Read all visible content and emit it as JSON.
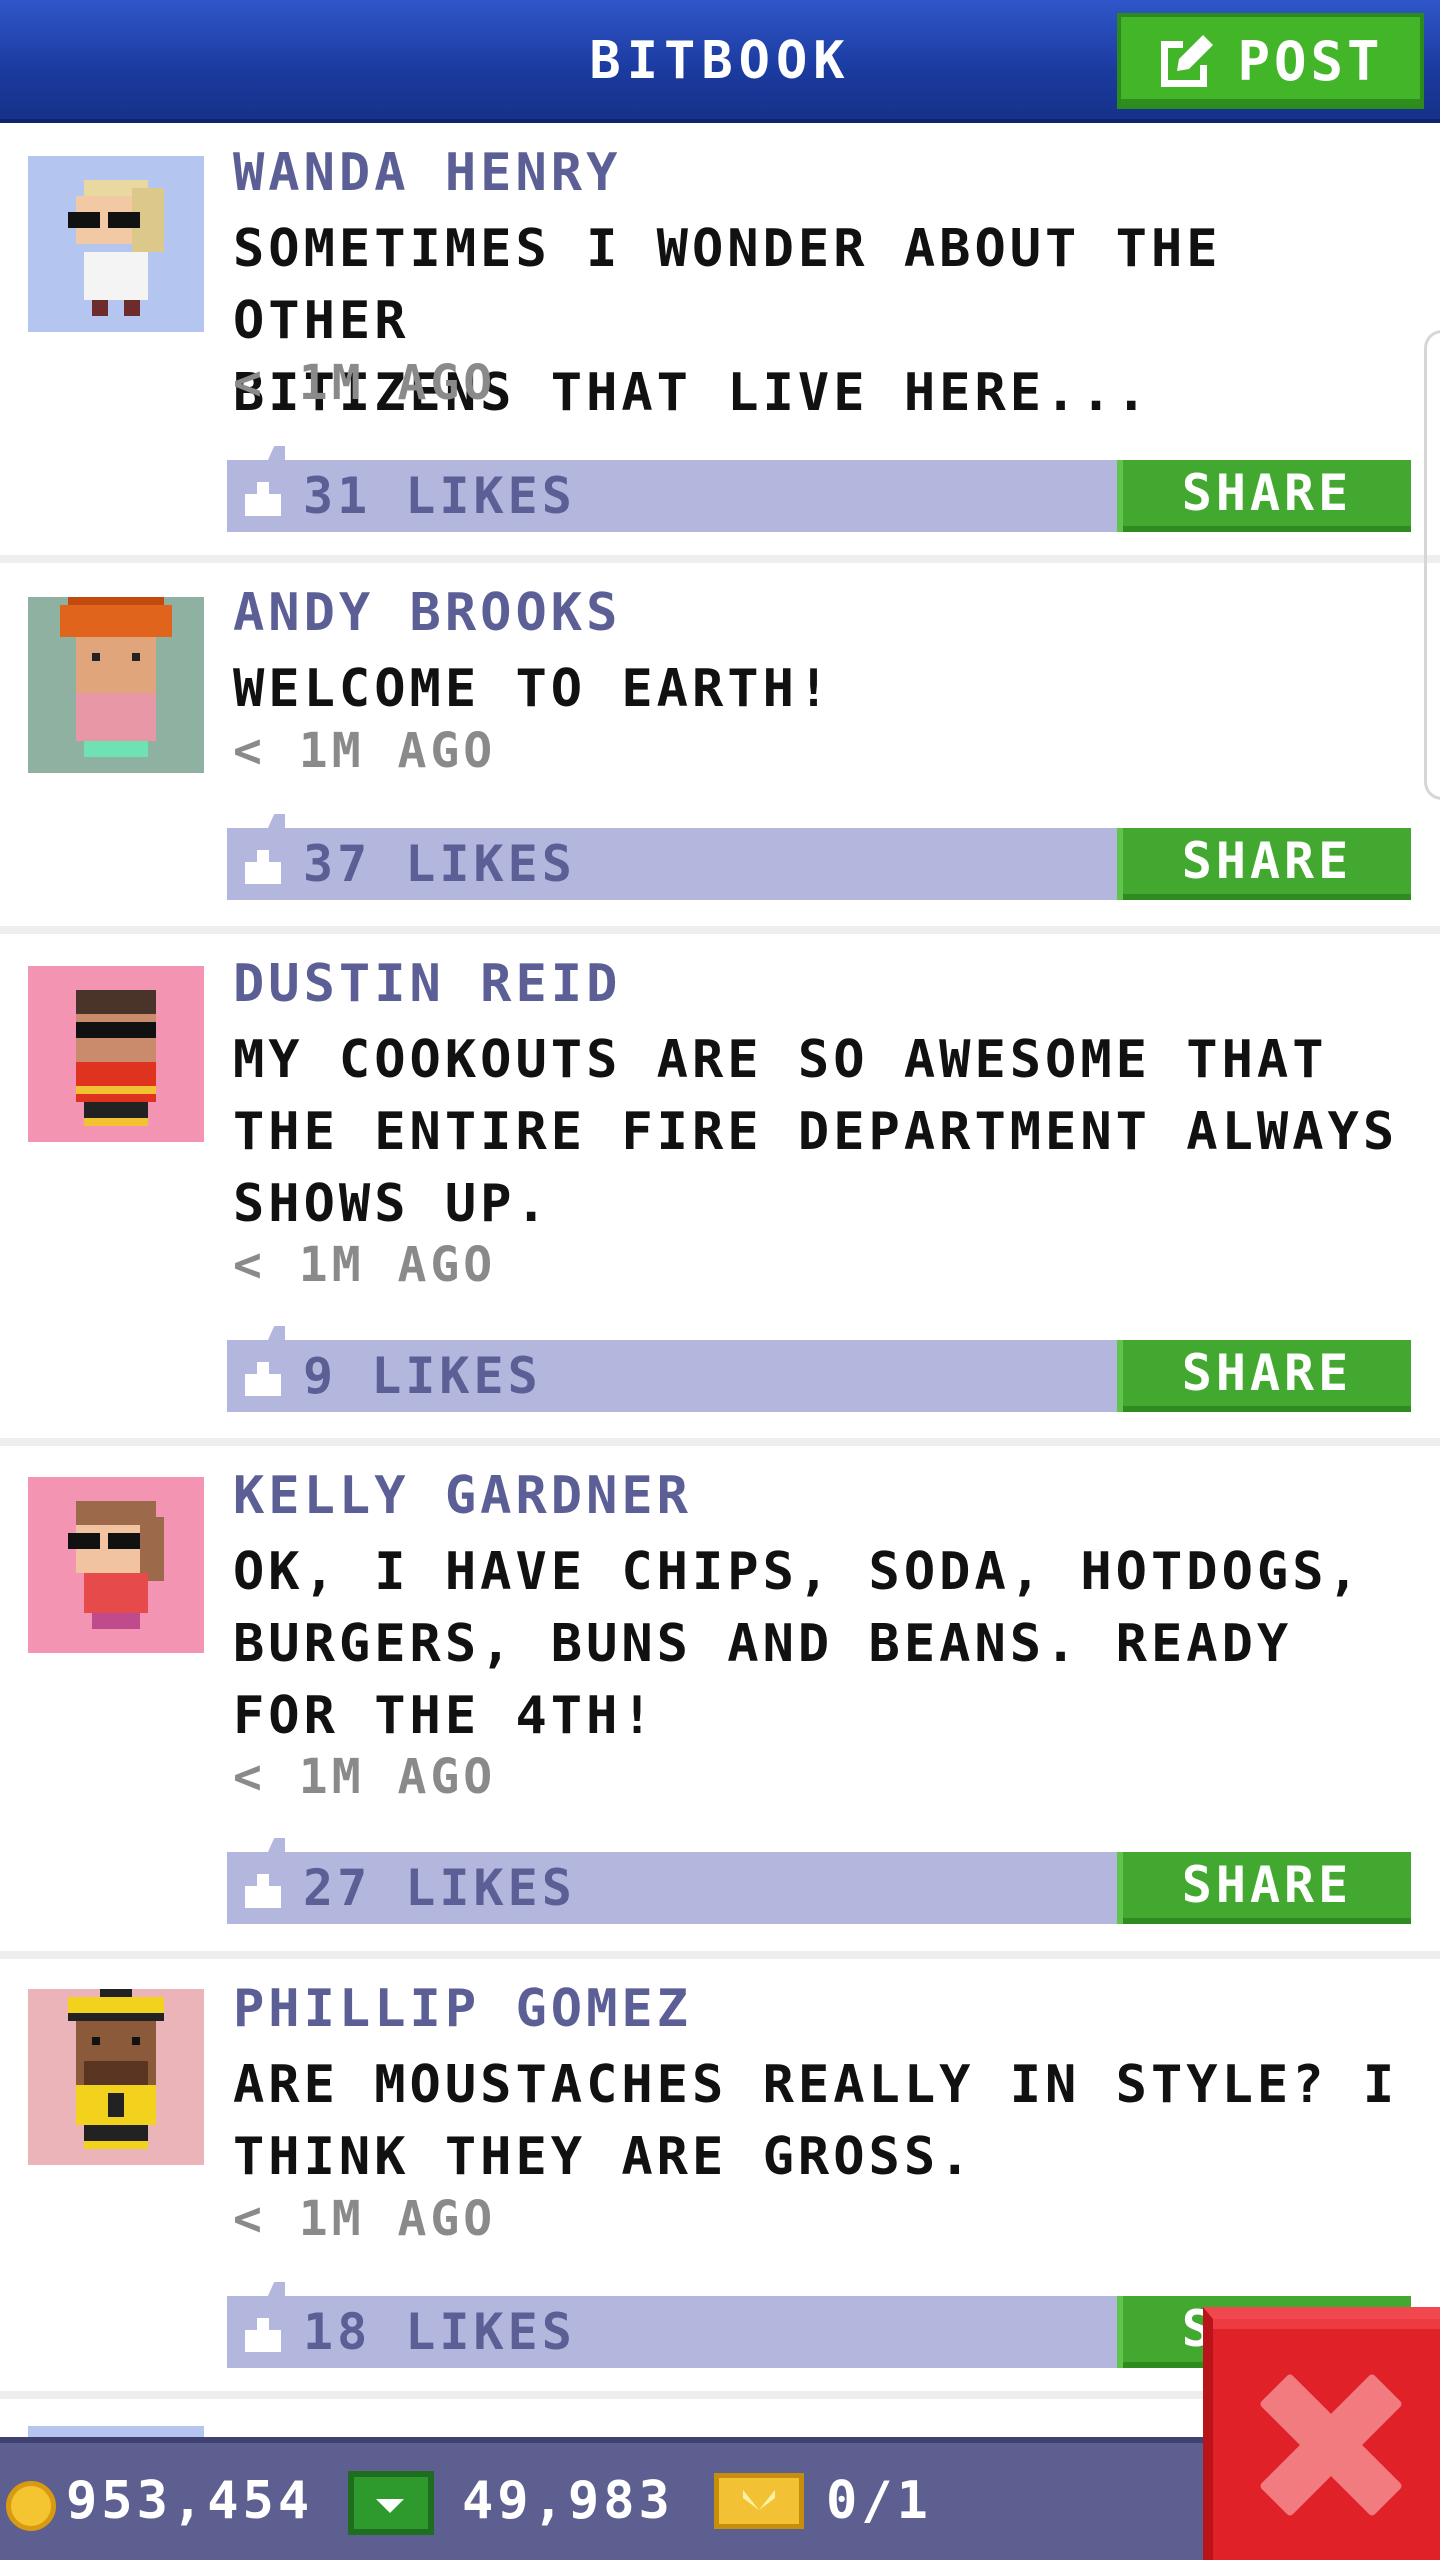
{
  "header": {
    "title": "BITBOOK",
    "post_label": "POST"
  },
  "posts": [
    {
      "name": "WANDA HENRY",
      "text": "SOMETIMES I WONDER ABOUT THE OTHER\nBITIZENS THAT LIVE HERE...",
      "time": "< 1M AGO",
      "likes": "31 LIKES",
      "share": "SHARE",
      "avatar_bg": "#b4c5f0"
    },
    {
      "name": "ANDY BROOKS",
      "text": "WELCOME TO EARTH!",
      "time": "< 1M AGO",
      "likes": "37 LIKES",
      "share": "SHARE",
      "avatar_bg": "#8fb1a1"
    },
    {
      "name": "DUSTIN REID",
      "text": "MY COOKOUTS ARE SO AWESOME THAT\nTHE ENTIRE FIRE DEPARTMENT ALWAYS\nSHOWS UP.",
      "time": "< 1M AGO",
      "likes": "9 LIKES",
      "share": "SHARE",
      "avatar_bg": "#f494b3"
    },
    {
      "name": "KELLY GARDNER",
      "text": "OK, I HAVE CHIPS, SODA, HOTDOGS,\nBURGERS, BUNS AND BEANS. READY\nFOR THE 4TH!",
      "time": "< 1M AGO",
      "likes": "27 LIKES",
      "share": "SHARE",
      "avatar_bg": "#f494b3"
    },
    {
      "name": "PHILLIP GOMEZ",
      "text": "ARE MOUSTACHES REALLY IN STYLE? I\nTHINK THEY ARE GROSS.",
      "time": "< 1M AGO",
      "likes": "18 LIKES",
      "share": "SHARE",
      "avatar_bg": "#eab4b8"
    }
  ],
  "footer": {
    "coins": "953,454",
    "bux": "49,983",
    "tickets": "0/1"
  },
  "colors": {
    "header_blue": "#1a3a9e",
    "accent_green": "#43b529",
    "name_purple": "#5c5f95",
    "likes_bar": "#b4b7dd",
    "close_red": "#e02128"
  },
  "icons": [
    "post-edit-icon",
    "like-icon",
    "coin-icon",
    "cash-icon",
    "ticket-icon",
    "close-icon"
  ]
}
